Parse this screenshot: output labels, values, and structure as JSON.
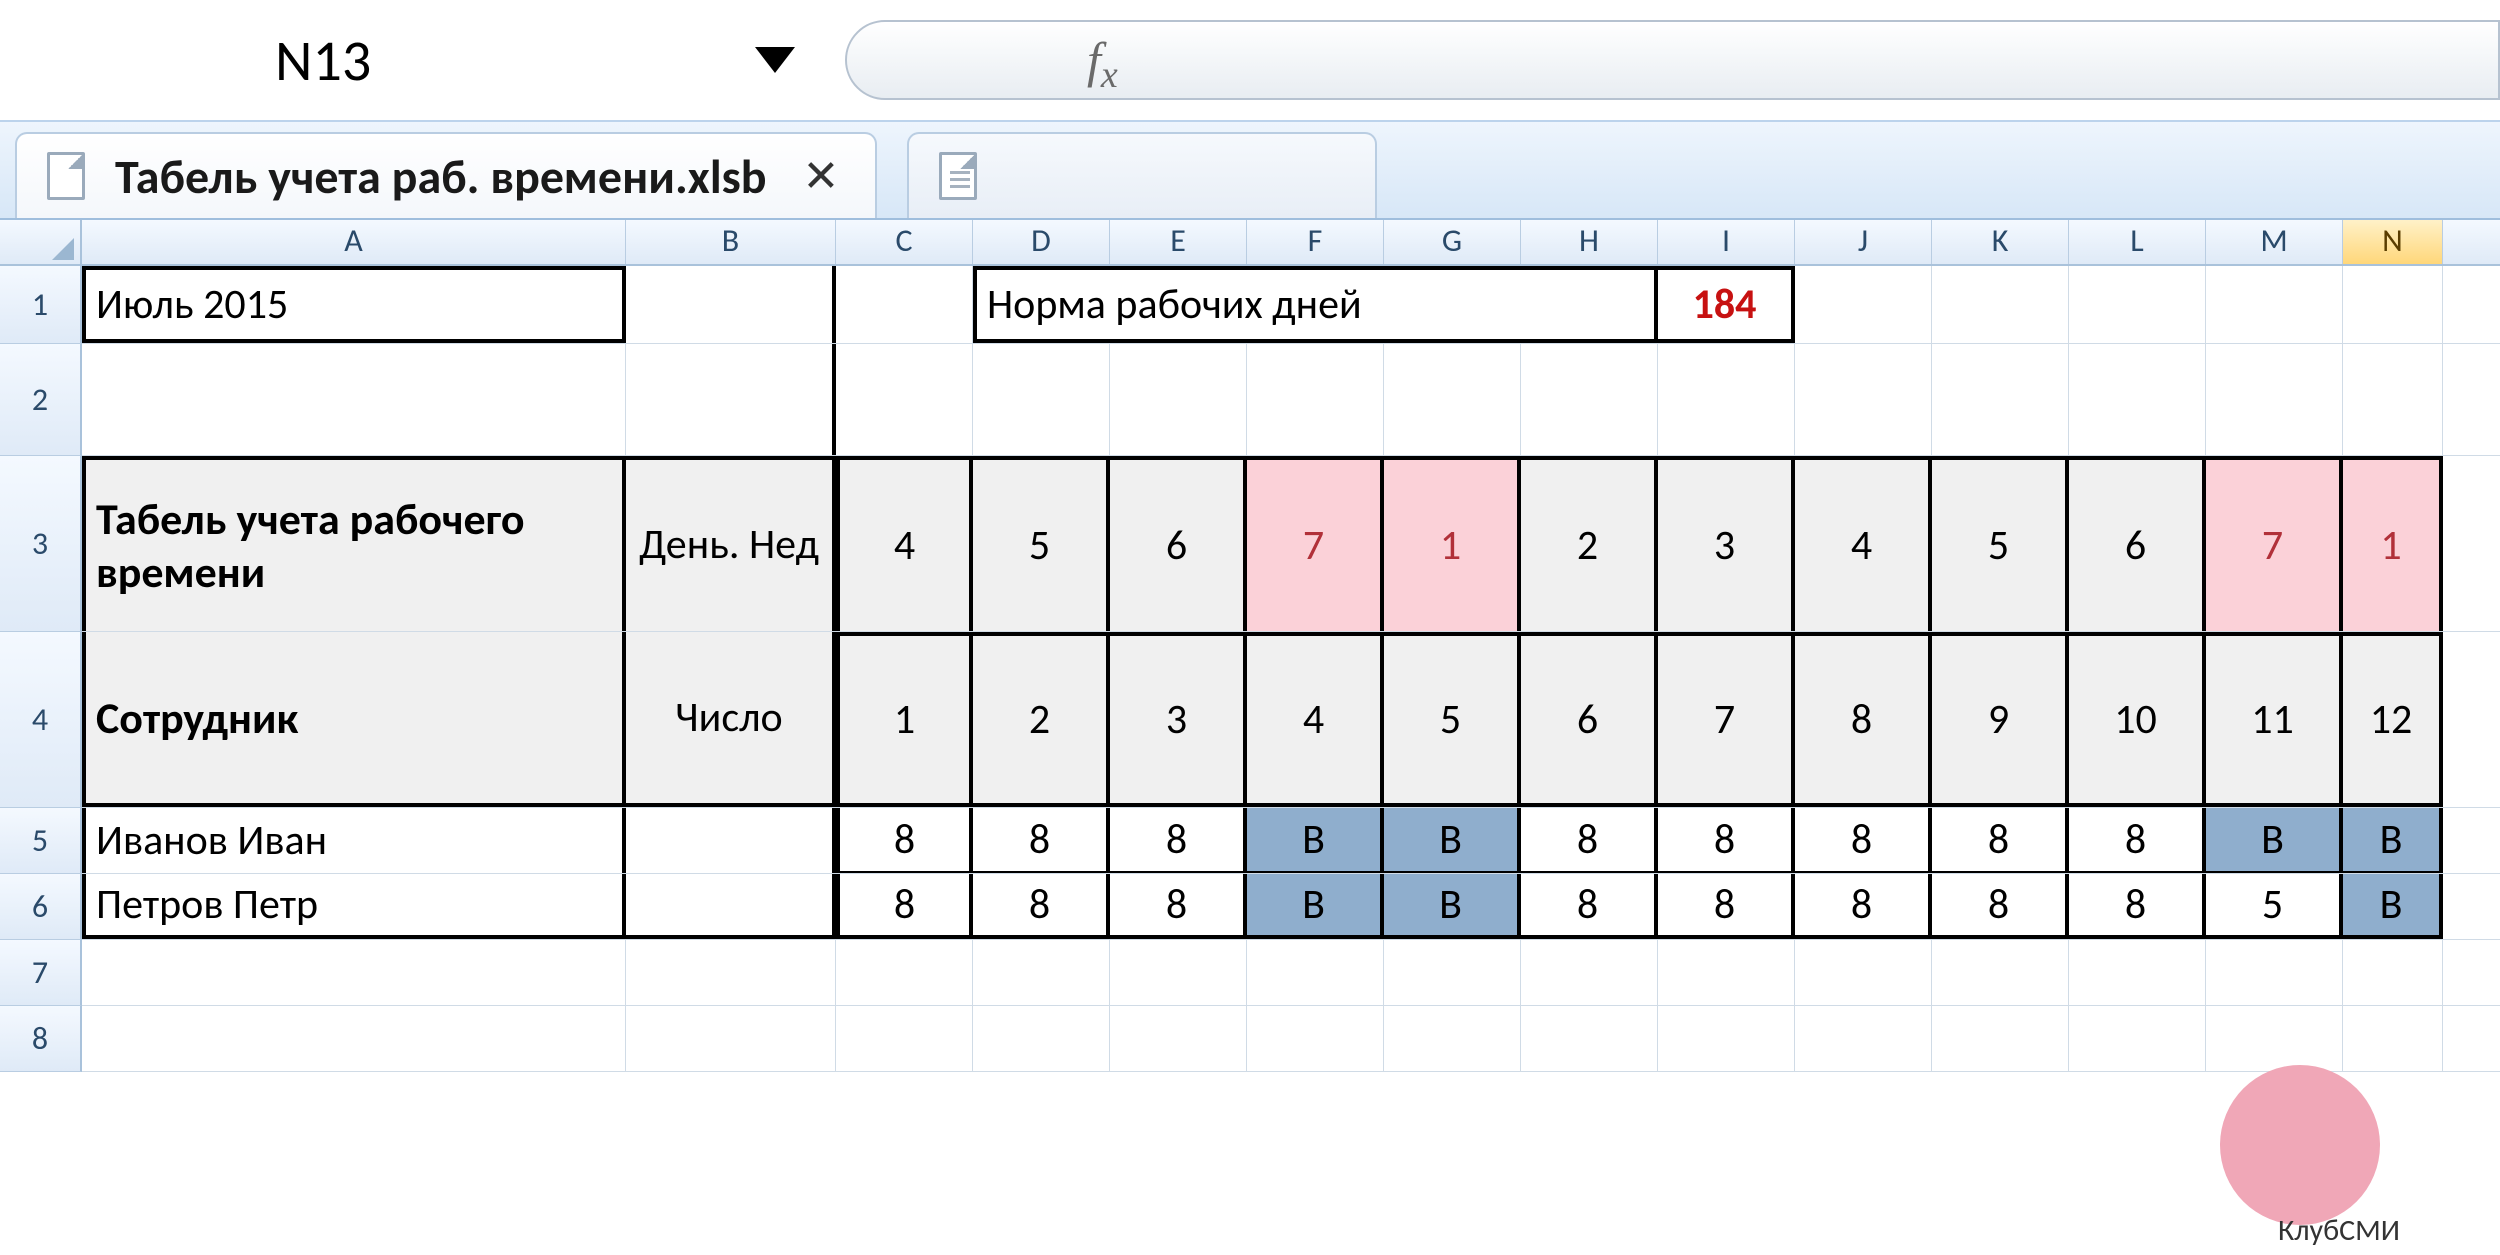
{
  "namebox": "N13",
  "formula": "",
  "tabs": {
    "file_title": "Табель учета раб. времени.xlsb"
  },
  "columns": [
    "A",
    "B",
    "C",
    "D",
    "E",
    "F",
    "G",
    "H",
    "I",
    "J",
    "K",
    "L",
    "M",
    "N"
  ],
  "selected_col": "N",
  "rows_visible": [
    "1",
    "2",
    "3",
    "4",
    "5",
    "6",
    "7",
    "8"
  ],
  "row1": {
    "A": "Июль 2015",
    "D_label": "Норма рабочих дней",
    "I_value": "184"
  },
  "row3": {
    "A": "Табель учета рабочего времени",
    "B": "День. Нед",
    "days": [
      "4",
      "5",
      "6",
      "7",
      "1",
      "2",
      "3",
      "4",
      "5",
      "6",
      "7",
      "1"
    ],
    "weekend_idx": [
      3,
      4,
      10,
      11
    ]
  },
  "row4": {
    "A": "Сотрудник",
    "B": "Число",
    "nums": [
      "1",
      "2",
      "3",
      "4",
      "5",
      "6",
      "7",
      "8",
      "9",
      "10",
      "11",
      "12"
    ]
  },
  "employees": [
    {
      "name": "Иванов Иван",
      "vals": [
        "8",
        "8",
        "8",
        "В",
        "В",
        "8",
        "8",
        "8",
        "8",
        "8",
        "В",
        "В"
      ],
      "off_idx": [
        3,
        4,
        10,
        11
      ]
    },
    {
      "name": "Петров Петр",
      "vals": [
        "8",
        "8",
        "8",
        "В",
        "В",
        "8",
        "8",
        "8",
        "8",
        "8",
        "5",
        "В"
      ],
      "off_idx": [
        3,
        4,
        11
      ]
    }
  ],
  "watermark": "КлубСМИ"
}
